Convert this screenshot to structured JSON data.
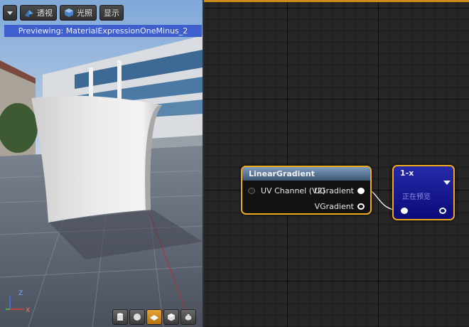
{
  "viewport": {
    "toolbar": {
      "dropdown_icon": "chevron-down-icon",
      "perspective_label": "透视",
      "lighting_label": "光照",
      "show_label": "显示"
    },
    "preview_text": "Previewing: MaterialExpressionOneMinus_2",
    "axis_labels": {
      "z": "Z",
      "x": "X"
    },
    "preview_shapes": [
      "cylinder",
      "sphere",
      "plane",
      "cube",
      "custom-mesh"
    ],
    "active_shape": "plane"
  },
  "graph": {
    "linear_gradient_node": {
      "title": "LinearGradient",
      "input_label": "UV Channel (V2)",
      "output_u": "UGradient",
      "output_v": "VGradient"
    },
    "one_minus_node": {
      "title": "1-x",
      "subtitle": "正在预览"
    }
  },
  "colors": {
    "selection_border": "#f0a81e",
    "preview_bar": "#3f5fcf",
    "node_header_lg": "#5c7a9c",
    "node_om_body": "#1a1e9c"
  }
}
